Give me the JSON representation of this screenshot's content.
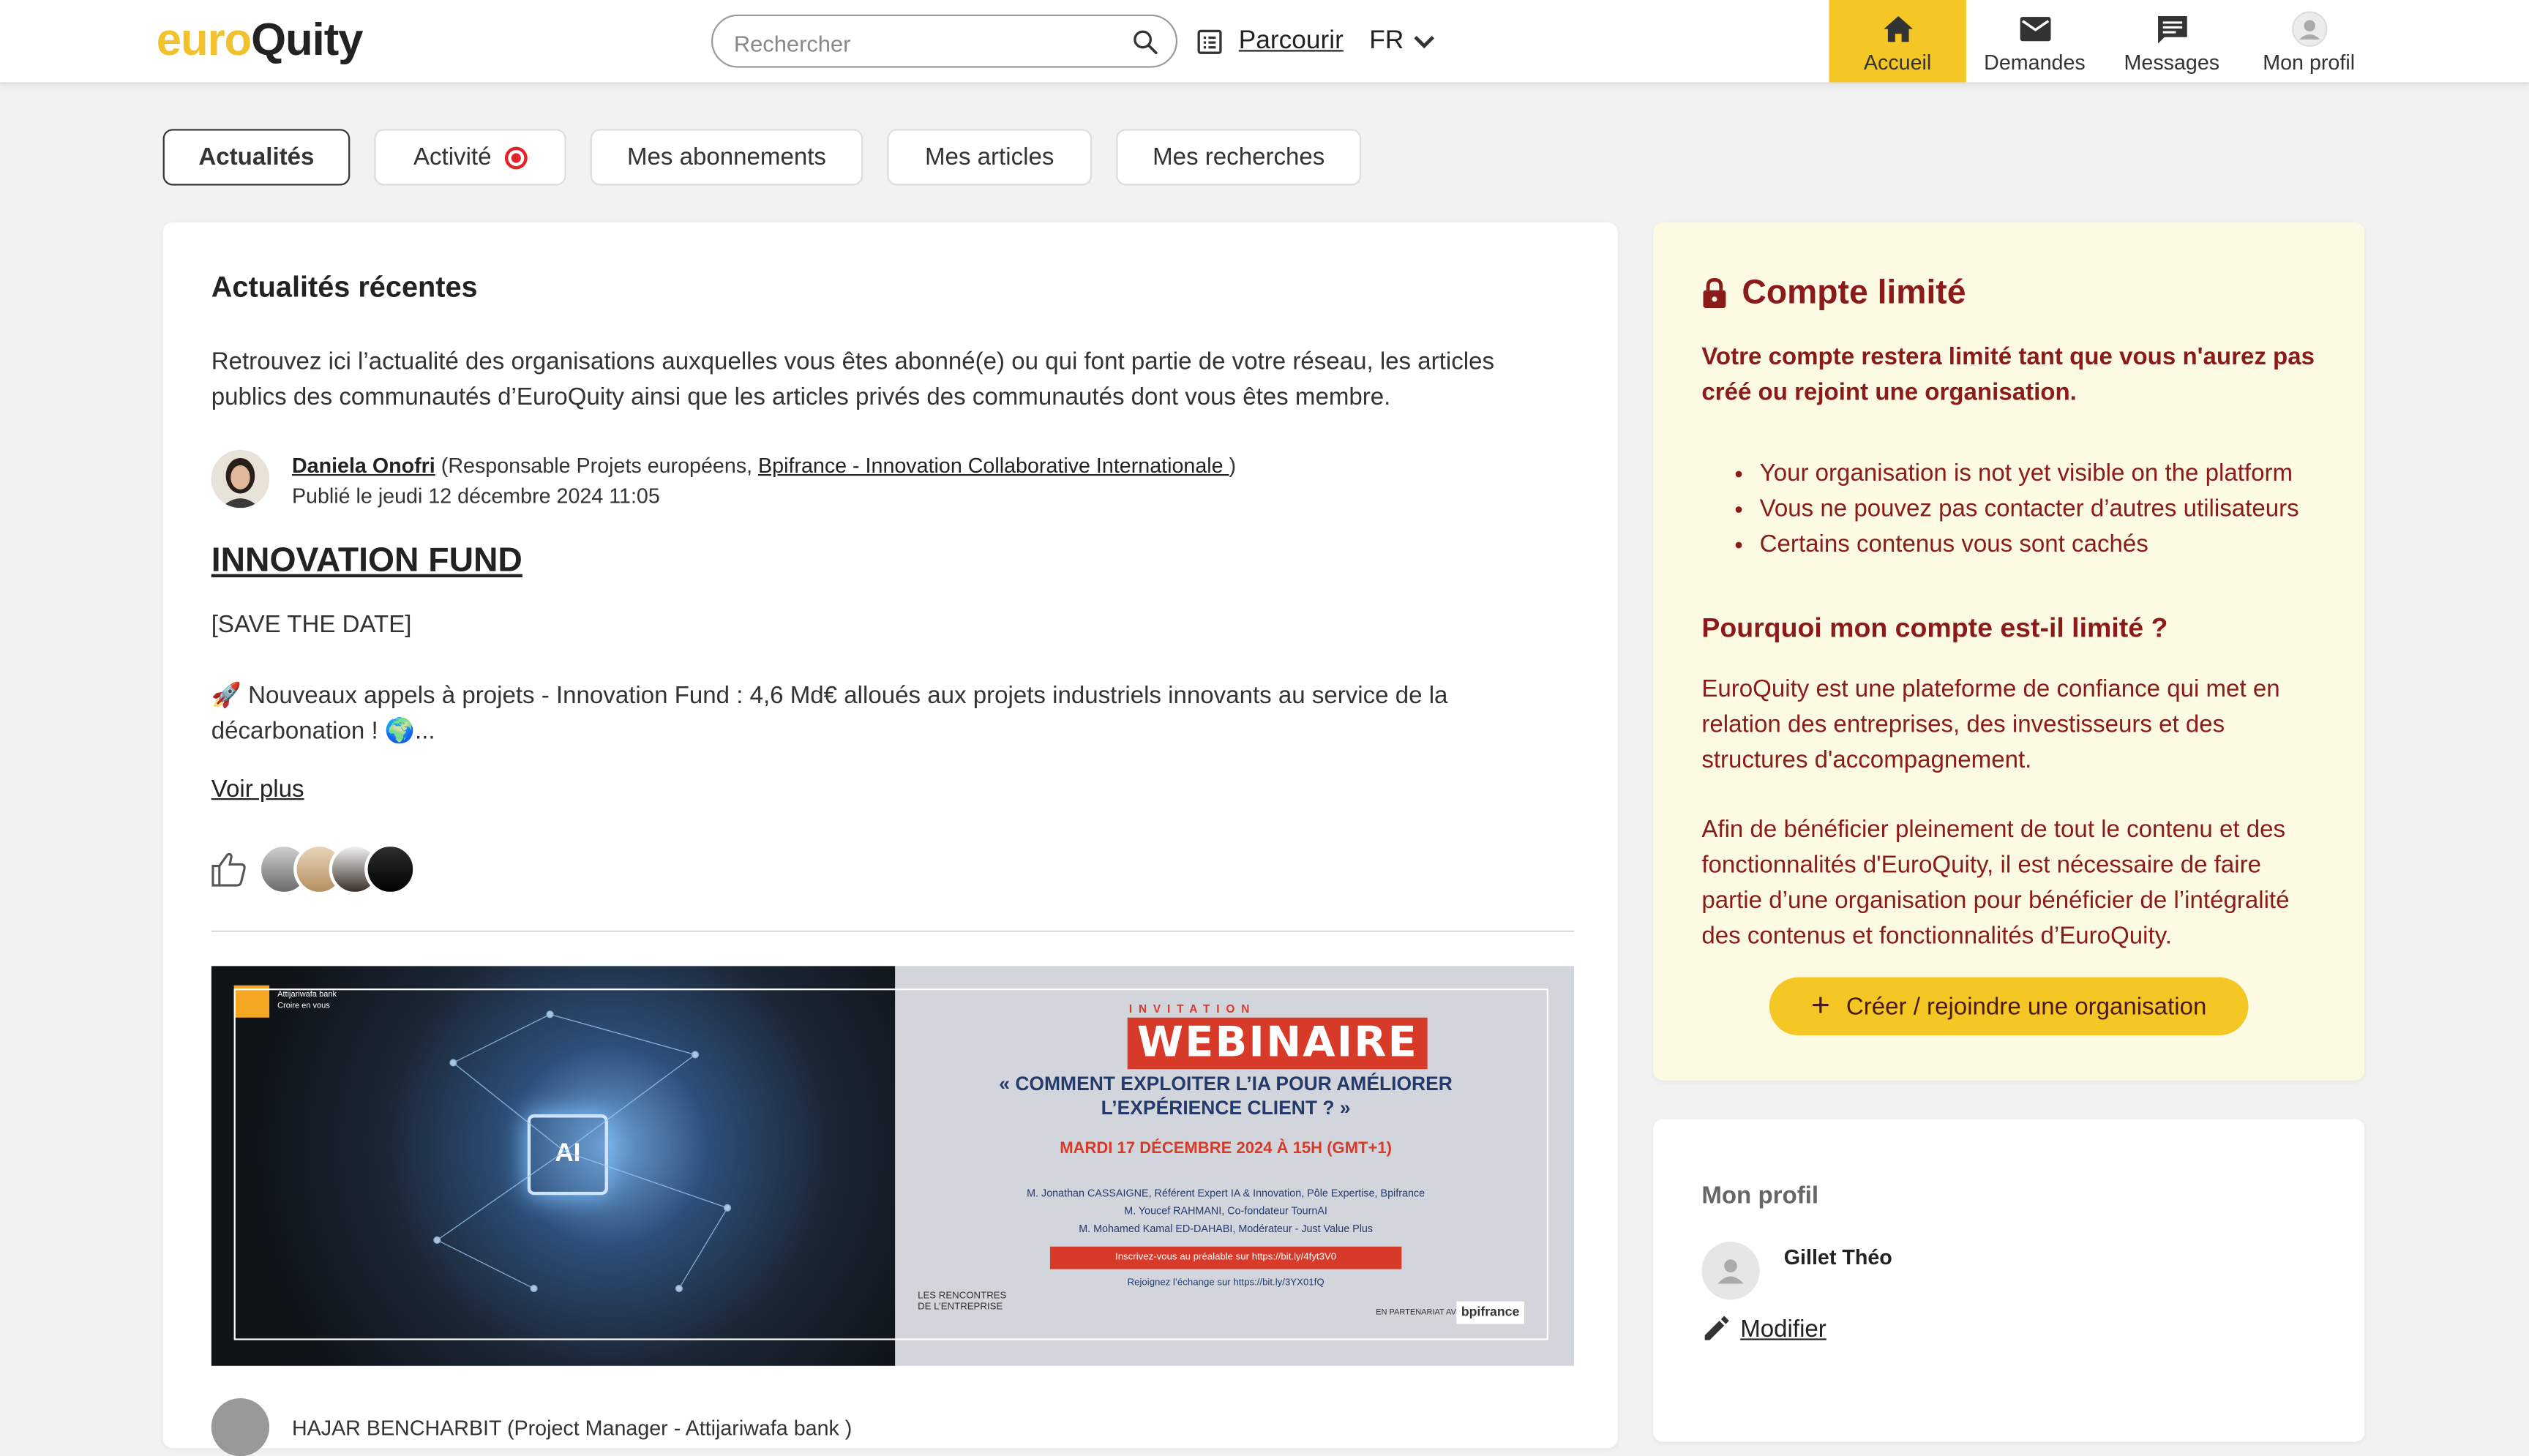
{
  "header": {
    "logo_part1": "euro",
    "logo_part2": "Quity",
    "search_placeholder": "Rechercher",
    "browse_label": "Parcourir",
    "lang_label": "FR",
    "nav": [
      {
        "label": "Accueil",
        "icon": "home-icon",
        "active": true
      },
      {
        "label": "Demandes",
        "icon": "envelope-icon"
      },
      {
        "label": "Messages",
        "icon": "chat-icon"
      },
      {
        "label": "Mon profil",
        "icon": "user-avatar-icon"
      }
    ]
  },
  "tabs": [
    {
      "label": "Actualités",
      "active": true
    },
    {
      "label": "Activité",
      "badge": true
    },
    {
      "label": "Mes abonnements"
    },
    {
      "label": "Mes articles"
    },
    {
      "label": "Mes recherches"
    }
  ],
  "feed": {
    "title": "Actualités récentes",
    "intro": "Retrouvez ici l’actualité des organisations auxquelles vous êtes abonné(e) ou qui font partie de votre réseau, les articles publics des communautés d’EuroQuity ainsi que les articles privés des communautés dont vous êtes membre.",
    "post": {
      "author_name": "Daniela Onofri",
      "author_role_prefix": "(Responsable Projets européens, ",
      "author_org": "Bpifrance - Innovation Collaborative Internationale ",
      "author_role_suffix": ")",
      "published": "Publié le jeudi 12 décembre 2024 11:05",
      "title": "INNOVATION FUND",
      "body_line1": "[SAVE THE DATE]",
      "body_line2": "🚀 Nouveaux appels à projets - Innovation Fund : 4,6 Md€ alloués aux projets industriels innovants au service de la décarbonation ! 🌍...",
      "read_more": "Voir plus"
    },
    "webinar": {
      "invitation": "INVITATION",
      "title": "WEBINAIRE",
      "question": "« COMMENT EXPLOITER L’IA POUR AMÉLIORER L’EXPÉRIENCE CLIENT ? »",
      "date": "MARDI 17 DÉCEMBRE 2024 À 15H (GMT+1)",
      "speakers": [
        "M. Jonathan CASSAIGNE, Référent Expert IA & Innovation, Pôle Expertise, Bpifrance",
        "M. Youcef RAHMANI, Co-fondateur TournAI",
        "M. Mohamed Kamal ED-DAHABI, Modérateur - Just Value Plus"
      ],
      "cta": "Inscrivez-vous au préalable sur https://bit.ly/4fyt3V0",
      "cta2": "Rejoignez l’échange sur https://bit.ly/3YX01fQ",
      "partner": "EN PARTENARIAT AVEC",
      "bpi": "bpifrance",
      "rencontres": "LES RENCONTRES DE L’ENTREPRISE",
      "bank_name": "Attijariwafa bank",
      "bank_tagline": "Croire en vous",
      "ai_chip": "AI"
    },
    "next_post_author": "HAJAR BENCHARBIT (Project Manager - Attijariwafa bank )"
  },
  "limited": {
    "title": "Compte limité",
    "warning": "Votre compte restera limité tant que vous n'aurez pas créé ou rejoint une organisation.",
    "bullets": [
      "Your organisation is not yet visible on the platform",
      "Vous ne pouvez pas contacter d’autres utilisateurs",
      "Certains contenus vous sont cachés"
    ],
    "why_title": "Pourquoi mon compte est-il limité ?",
    "why_p1": "EuroQuity est une plateforme de confiance qui met en relation des entreprises, des investisseurs et des structures d'accompagnement.",
    "why_p2": "Afin de bénéficier pleinement de tout le contenu et des fonctionnalités d'EuroQuity, il est nécessaire de faire partie d’une organisation pour bénéficier de l’intégralité des contenus et fonctionnalités d’EuroQuity.",
    "create_button": "Créer / rejoindre une organisation"
  },
  "profile": {
    "title": "Mon profil",
    "name": "Gillet Théo",
    "edit_label": "Modifier"
  }
}
